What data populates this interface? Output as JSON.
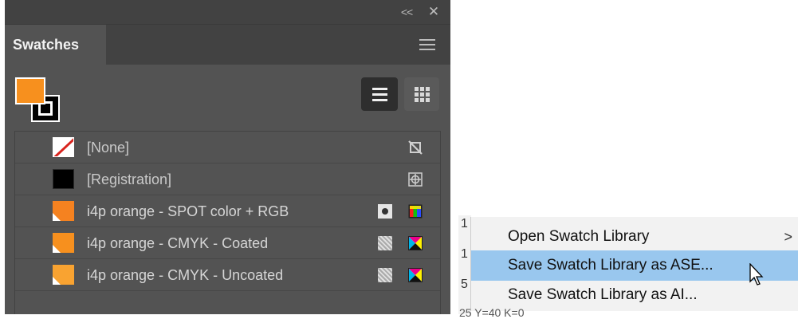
{
  "panel": {
    "title": "Swatches",
    "window_buttons": {
      "collapse": "<<",
      "close": "✕"
    },
    "fill_color": "#f7901e",
    "stroke_color": "#000000",
    "view_mode": "list"
  },
  "swatches": [
    {
      "name": "[None]",
      "chip": "none"
    },
    {
      "name": "[Registration]",
      "chip": "registration"
    },
    {
      "name": "i4p orange - SPOT color + RGB",
      "chip": "orange",
      "type": "spot",
      "mode": "rgb"
    },
    {
      "name": "i4p orange - CMYK - Coated",
      "chip": "orange",
      "type": "process",
      "mode": "cmyk"
    },
    {
      "name": "i4p orange - CMYK - Uncoated",
      "chip": "orange",
      "type": "process",
      "mode": "cmyk"
    }
  ],
  "menu": {
    "items": [
      {
        "label": "Open Swatch Library",
        "submenu_arrow": ">"
      },
      {
        "label": "Save Swatch Library as ASE...",
        "highlighted": true
      },
      {
        "label": "Save Swatch Library as AI..."
      }
    ],
    "edge_chars": [
      "1",
      "1",
      "5"
    ],
    "bottom_text": "25 Y=40 K=0",
    "highlight_color": "#99c7ee"
  },
  "colors": {
    "panel_bg": "#535353",
    "panel_header_bg": "#424242",
    "accent_orange": "#f7901e"
  }
}
